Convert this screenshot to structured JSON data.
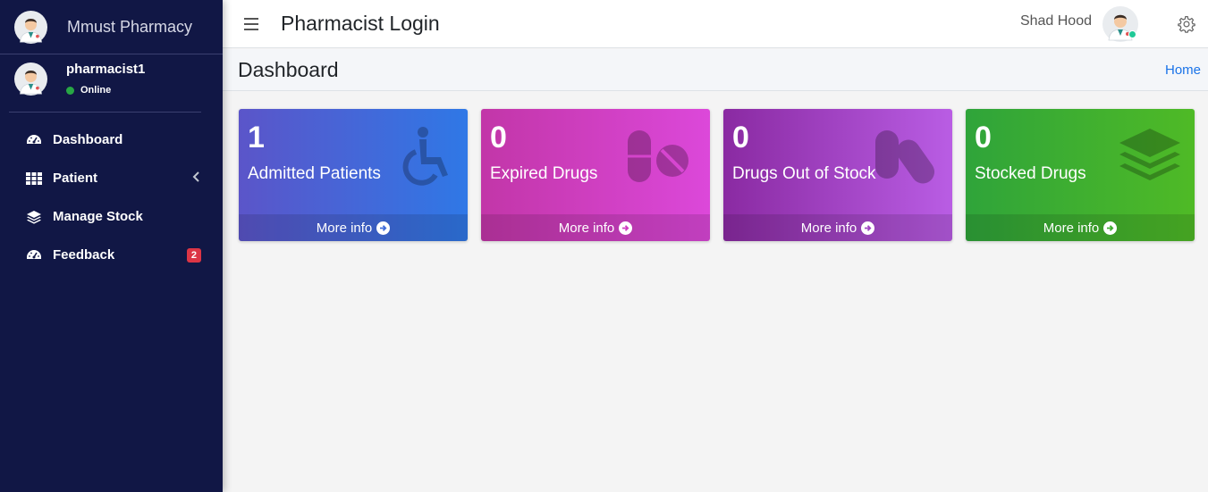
{
  "brand": {
    "name": "Mmust Pharmacy"
  },
  "sidebar_user": {
    "name": "pharmacist1",
    "status": "Online"
  },
  "nav": [
    {
      "label": "Dashboard",
      "icon": "tachometer-icon"
    },
    {
      "label": "Patient",
      "icon": "grid-icon",
      "has_submenu": true
    },
    {
      "label": "Manage Stock",
      "icon": "layers-icon"
    },
    {
      "label": "Feedback",
      "icon": "tachometer-icon",
      "badge": "2"
    }
  ],
  "topbar": {
    "title": "Pharmacist Login",
    "user_name": "Shad Hood"
  },
  "content": {
    "page_title": "Dashboard",
    "breadcrumb": "Home"
  },
  "cards": [
    {
      "count": "1",
      "label": "Admitted Patients",
      "footer": "More info",
      "icon": "wheelchair-icon"
    },
    {
      "count": "0",
      "label": "Expired Drugs",
      "footer": "More info",
      "icon": "pills-icon"
    },
    {
      "count": "0",
      "label": "Drugs Out of Stock",
      "footer": "More info",
      "icon": "capsules-icon"
    },
    {
      "count": "0",
      "label": "Stocked Drugs",
      "footer": "More info",
      "icon": "layers-icon"
    }
  ],
  "colors": {
    "sidebar_bg": "#111745",
    "card_admitted": "#3f6bd9",
    "card_expired": "#cf3fc1",
    "card_out_of_stock": "#a044c3",
    "card_stocked": "#3fae30",
    "badge": "#dc3545",
    "online": "#28a745"
  }
}
